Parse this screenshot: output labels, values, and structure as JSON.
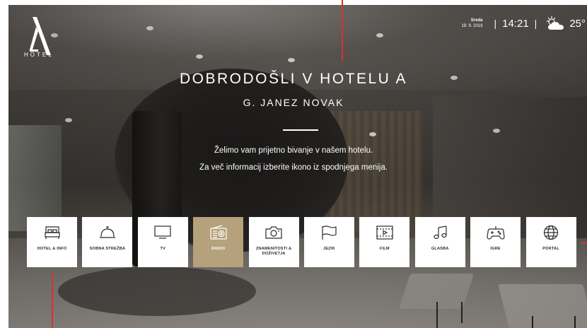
{
  "logo": {
    "text": "HOTEL"
  },
  "status": {
    "day": "Sreda",
    "date": "19. 9. 2019",
    "separator": "|",
    "time": "14:21",
    "temperature": "25°"
  },
  "welcome": {
    "title": "DOBRODOŠLI V HOTELU A",
    "guest": "G. JANEZ NOVAK",
    "message_line1": "Želimo vam prijetno bivanje v našem hotelu.",
    "message_line2": "Za več informacij izberite ikono iz spodnjega menija."
  },
  "menu": {
    "active_color": "#b5a27c",
    "items": [
      {
        "label": "HOTEL & INFO",
        "icon": "bed-icon"
      },
      {
        "label": "SOBNA STREŽBA",
        "icon": "room-service-bell-icon"
      },
      {
        "label": "TV",
        "icon": "tv-icon"
      },
      {
        "label": "RADIO",
        "icon": "radio-icon",
        "active": true
      },
      {
        "label": "ZNAMENITOSTI & DOŽIVETJA",
        "icon": "camera-icon"
      },
      {
        "label": "JEZIK",
        "icon": "flag-icon"
      },
      {
        "label": "FILM",
        "icon": "film-icon"
      },
      {
        "label": "GLASBA",
        "icon": "music-note-icon"
      },
      {
        "label": "IGRE",
        "icon": "gamepad-icon"
      },
      {
        "label": "PORTAL",
        "icon": "globe-icon"
      }
    ]
  },
  "annotation_color": "#d8332f"
}
